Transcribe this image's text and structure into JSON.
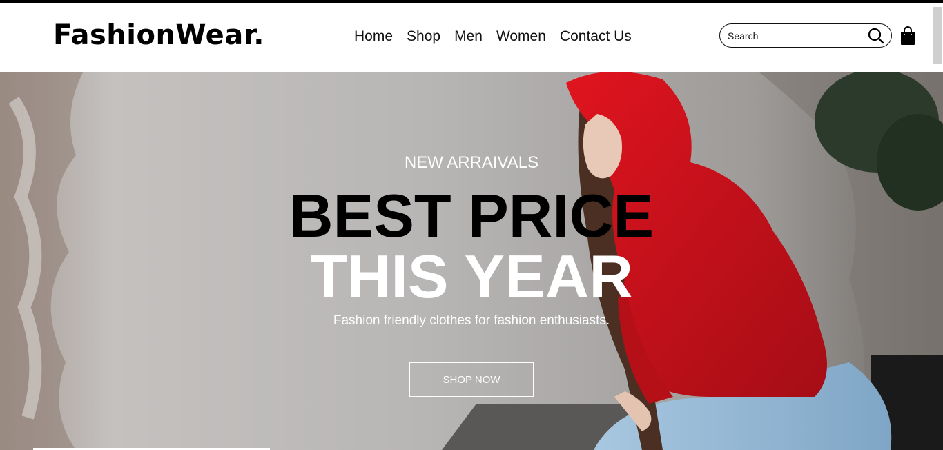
{
  "brand": {
    "logo": "FashionWear."
  },
  "nav": {
    "items": [
      "Home",
      "Shop",
      "Men",
      "Women",
      "Contact Us"
    ]
  },
  "search": {
    "placeholder": "Search",
    "icon": "search-icon"
  },
  "cart": {
    "icon": "shopping-bag-icon"
  },
  "hero": {
    "eyebrow": "NEW ARRAIVALS",
    "headline_line1": "BEST PRICE",
    "headline_line2": "THIS YEAR",
    "tagline": "Fashion friendly clothes for fashion enthusiasts.",
    "cta_label": "SHOP NOW",
    "image": "woman-in-red-hoodie-photo"
  },
  "colors": {
    "accent_red": "#c8101a",
    "text_dark": "#000000",
    "text_light": "#ffffff",
    "wall_gray": "#b3b1b0"
  }
}
